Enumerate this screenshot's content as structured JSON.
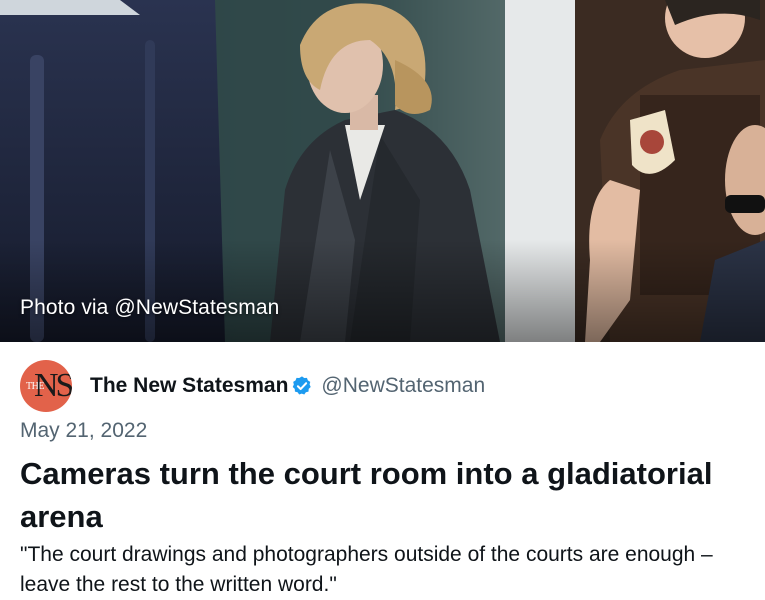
{
  "photo": {
    "caption": "Photo via @NewStatesman"
  },
  "author": {
    "avatar_small_text": "THE",
    "avatar_big_text": "NS",
    "name": "The New Statesman",
    "handle": "@NewStatesman",
    "verified": true,
    "avatar_color": "#e2624a"
  },
  "article": {
    "date": "May 21, 2022",
    "headline": "Cameras turn the court room into a gladiatorial arena",
    "excerpt": "\"The court drawings and photographers outside of the courts are enough – leave the rest to the written word.\""
  },
  "colors": {
    "verified_blue": "#1d9bf0",
    "secondary_text": "#536471",
    "primary_text": "#0f1419"
  }
}
